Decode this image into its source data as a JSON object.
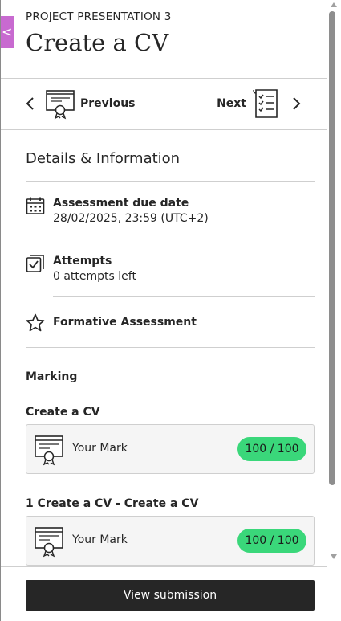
{
  "header": {
    "eyebrow": "PROJECT PRESENTATION 3",
    "title": "Create a CV",
    "close_glyph": "<"
  },
  "nav": {
    "previous_label": "Previous",
    "next_label": "Next"
  },
  "details": {
    "title": "Details & Information",
    "due": {
      "title": "Assessment due date",
      "value": "28/02/2025, 23:59 (UTC+2)",
      "icon": "calendar-icon"
    },
    "attempts": {
      "title": "Attempts",
      "value": "0 attempts left",
      "icon": "checkbox-icon"
    },
    "formative": {
      "title": "Formative Assessment",
      "icon": "star-icon"
    }
  },
  "marking": {
    "label": "Marking",
    "items": [
      {
        "label": "Create a CV",
        "mark_label": "Your Mark",
        "score": "100 / 100"
      },
      {
        "label": "1 Create a CV - Create a CV",
        "mark_label": "Your Mark",
        "score": "100 / 100"
      }
    ]
  },
  "footer": {
    "view_submission": "View submission"
  },
  "colors": {
    "accent_tab": "#c86ad0",
    "score_pill": "#3ad77a",
    "button_dark": "#262626"
  }
}
